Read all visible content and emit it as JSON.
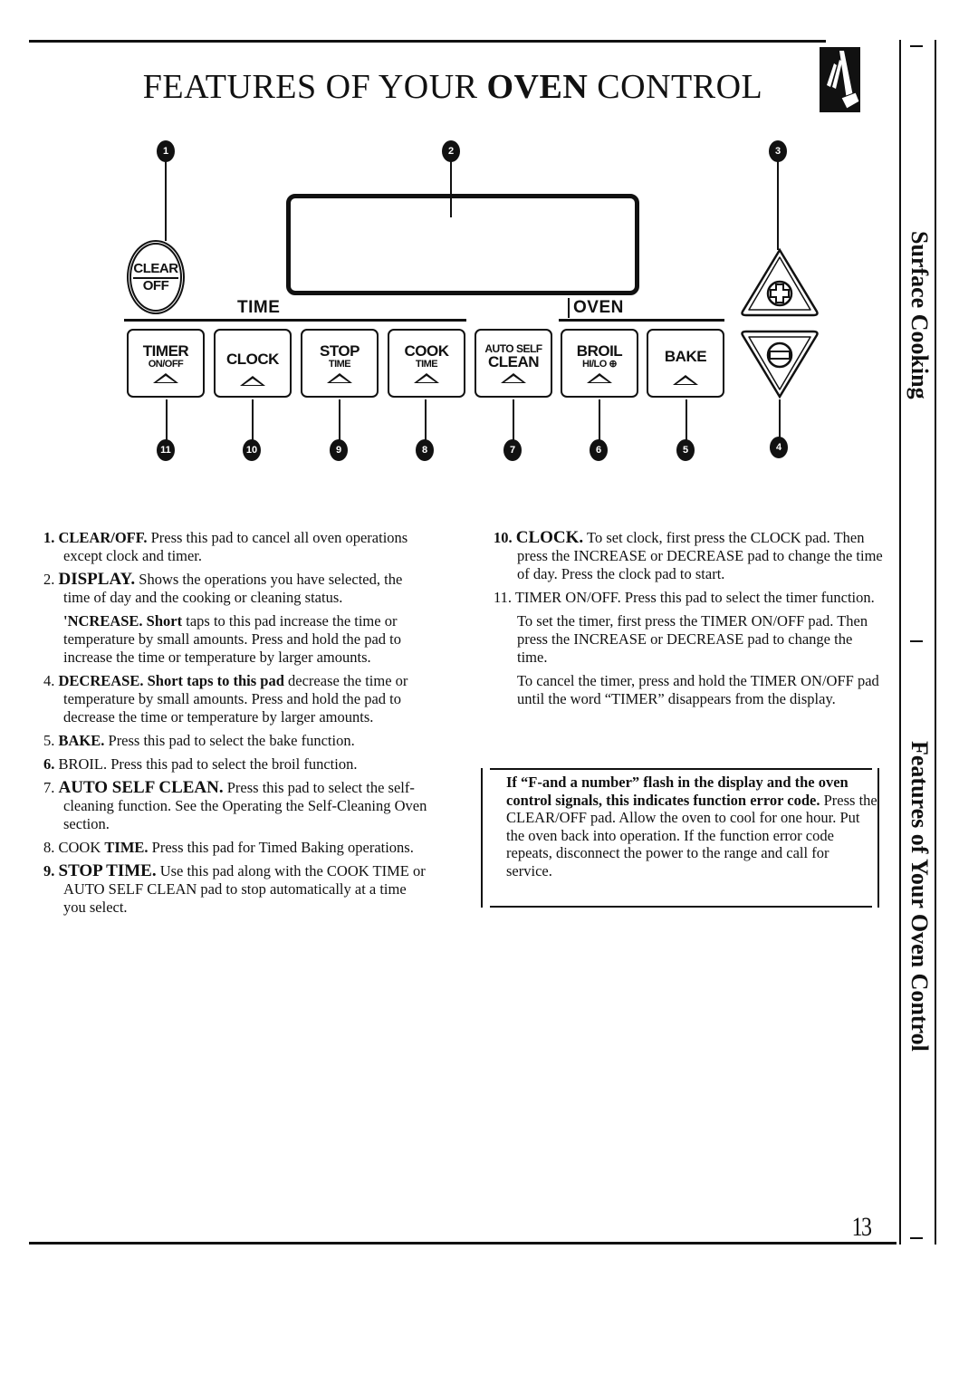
{
  "page": {
    "title_pre": "FEATURES OF YOUR ",
    "title_bold": "OVEN",
    "title_post": " CONTROL",
    "page_number": "13",
    "side_tabs": [
      "Surface Cooking",
      "Features of Your Oven Control"
    ]
  },
  "diagram": {
    "callouts": [
      "1",
      "2",
      "3",
      "4",
      "5",
      "6",
      "7",
      "8",
      "9",
      "10",
      "11"
    ],
    "clear_off": {
      "top": "CLEAR",
      "bottom": "OFF"
    },
    "group_time": "TIME",
    "group_oven": "OVEN",
    "pads": [
      {
        "id": "timer",
        "main": "TIMER",
        "sub": "ON/OFF",
        "callout": "11"
      },
      {
        "id": "clock",
        "main": "CLOCK",
        "sub": "",
        "callout": "10"
      },
      {
        "id": "stop-time",
        "main": "STOP",
        "sub": "TIME",
        "callout": "9"
      },
      {
        "id": "cook-time",
        "main": "COOK",
        "sub": "TIME",
        "callout": "8"
      },
      {
        "id": "auto-self-clean",
        "top": "AUTO SELF",
        "main": "CLEAN",
        "callout": "7"
      },
      {
        "id": "broil",
        "main": "BROIL",
        "sub": "HI/LO ⊕",
        "callout": "6"
      },
      {
        "id": "bake",
        "main": "BAKE",
        "sub": "",
        "callout": "5"
      }
    ],
    "increase_icon": "plus-circle-icon",
    "decrease_icon": "minus-circle-icon"
  },
  "descriptions_left": {
    "i1_num": "1.",
    "i1_head": "CLEAR/OFF.",
    "i1_text": " Press this pad to cancel all oven operations except clock and timer.",
    "i2_num": "2.",
    "i2_head": "DISPLAY.",
    "i2_text": " Shows the operations you have selected, the time of day and the cooking or cleaning status.",
    "i3_head": "'NCREASE. Short",
    "i3_text": " taps to this pad increase the time or temperature by small amounts. Press and hold the pad to increase the time or temperature by larger amounts.",
    "i4_num": "4.",
    "i4_head": "DECREASE. Short taps to this pad",
    "i4_text": " decrease the time or temperature by small amounts. Press and hold the pad to decrease the time or temperature by larger amounts.",
    "i5_num": "5.",
    "i5_head": "BAKE.",
    "i5_text": " Press this pad to select the bake function.",
    "i6_num": "6.",
    "i6_head": "BROIL.",
    "i6_text": " Press this pad to select the broil function.",
    "i7_num": "7.",
    "i7_head": "AUTO SELF CLEAN.",
    "i7_text": " Press this pad to select the self-cleaning function. See the Operating the Self-Cleaning Oven section.",
    "i8_num": "8.",
    "i8_head_pre": "COOK ",
    "i8_head": "TIME.",
    "i8_text": " Press this pad for Timed Baking operations.",
    "i9_num": "9.",
    "i9_head": "STOP TIME.",
    "i9_text": " Use this pad along with the COOK TIME or AUTO SELF CLEAN pad to stop automatically at a time you select."
  },
  "descriptions_right": {
    "i10_num": "10.",
    "i10_head": "CLOCK.",
    "i10_text": " To set clock, first press the CLOCK pad. Then press the INCREASE or DECREASE pad to change the time of day. Press the clock pad to start.",
    "i11_num": "11.",
    "i11_text": " TIMER ON/OFF. Press this pad to select the timer function.",
    "p_set_timer": "To set the timer, first press the TIMER ON/OFF pad. Then press the INCREASE or DECREASE pad to change the time.",
    "p_cancel_timer": "To cancel the timer, press and hold the TIMER ON/OFF pad until the word “TIMER” disappears from the display."
  },
  "notice": {
    "bold_text": "If “F-and a number” flash in the display and the oven control signals, this indicates function error code.",
    "text": " Press the CLEAR/OFF pad. Allow the oven to cool for one hour. Put the oven back into operation. If the function error code repeats, disconnect the power to the range and call for service."
  }
}
